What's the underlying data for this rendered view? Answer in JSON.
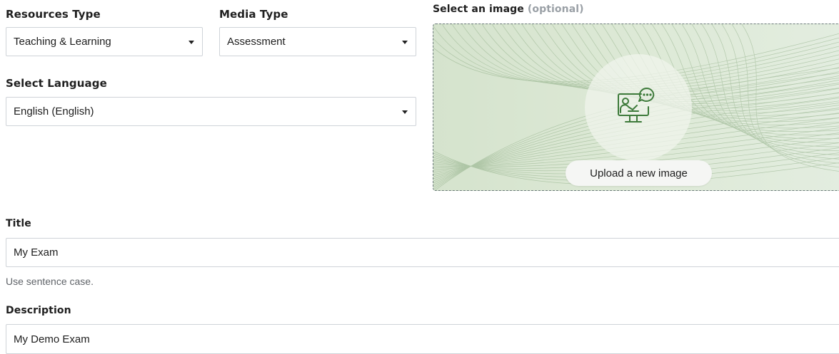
{
  "resources_type": {
    "label": "Resources Type",
    "value": "Teaching & Learning"
  },
  "media_type": {
    "label": "Media Type",
    "value": "Assessment"
  },
  "language": {
    "label": "Select Language",
    "value": "English (English)"
  },
  "image": {
    "label": "Select an image",
    "optional_text": "(optional)",
    "upload_button": "Upload a new image",
    "icon": "teacher-presentation-icon"
  },
  "title": {
    "label": "Title",
    "value": "My Exam",
    "hint": "Use sentence case."
  },
  "description": {
    "label": "Description",
    "value": "My Demo Exam"
  },
  "colors": {
    "dropzone_bg": "#dde9d6",
    "icon_green": "#3d7a3a",
    "border": "#cfd3d8"
  }
}
